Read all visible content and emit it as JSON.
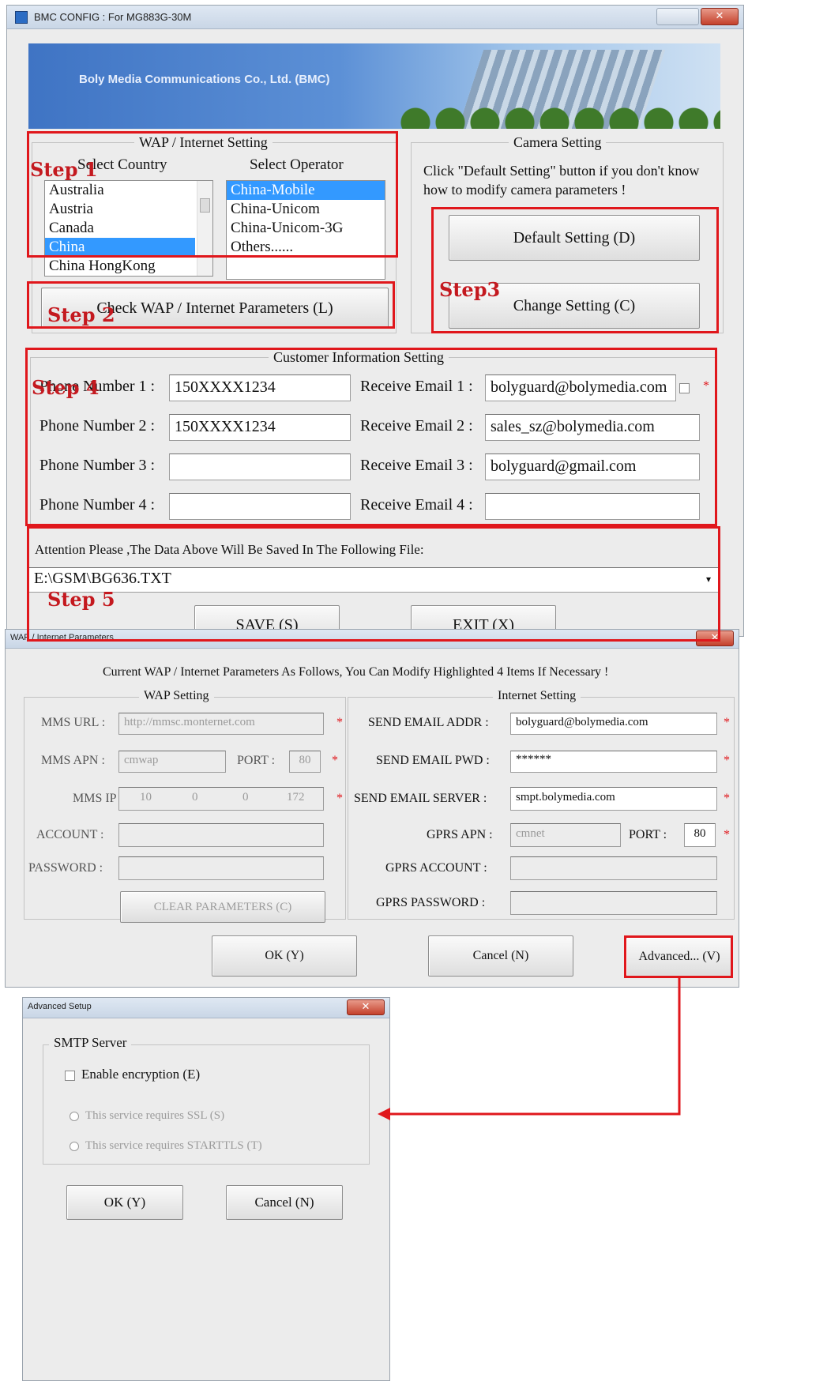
{
  "main_window": {
    "title": "BMC CONFIG : For MG883G-30M",
    "banner_text": "Boly Media Communications Co., Ltd. (BMC)",
    "wap_group": {
      "label": "WAP / Internet Setting",
      "country_label": "Select Country",
      "operator_label": "Select Operator",
      "countries": [
        "Australia",
        "Austria",
        "Canada",
        "China",
        "China HongKong"
      ],
      "selected_country": "China",
      "operators": [
        "China-Mobile",
        "China-Unicom",
        "China-Unicom-3G",
        "Others......"
      ],
      "selected_operator": "China-Mobile",
      "check_button": "Check WAP / Internet Parameters (L)"
    },
    "camera_group": {
      "label": "Camera Setting",
      "hint": "Click \"Default Setting\" button if you don't know how to modify camera parameters !",
      "default_button": "Default Setting (D)",
      "change_button": "Change Setting (C)"
    },
    "customer_group": {
      "label": "Customer Information Setting",
      "phone_labels": [
        "Phone Number 1 :",
        "Phone Number 2 :",
        "Phone Number 3 :",
        "Phone Number 4 :"
      ],
      "phone_values": [
        "150XXXX1234",
        "150XXXX1234",
        "",
        ""
      ],
      "email_labels": [
        "Receive Email 1 :",
        "Receive Email 2 :",
        "Receive Email 3 :",
        "Receive Email 4 :"
      ],
      "email_values": [
        "bolyguard@bolymedia.com",
        "sales_sz@bolymedia.com",
        "bolyguard@gmail.com",
        ""
      ]
    },
    "attention_text": "Attention Please ,The Data Above Will Be Saved In The Following  File:",
    "file_path": "E:\\GSM\\BG636.TXT",
    "save_button": "SAVE (S)",
    "exit_button": "EXIT (X)"
  },
  "steps": [
    "Step 1",
    "Step 2",
    "Step3",
    "Step 4",
    "Step 5"
  ],
  "wap_dialog": {
    "title": "WAP / Internet Parameters",
    "instruction": "Current WAP / Internet Parameters As Follows, You Can Modify Highlighted 4 Items If Necessary !",
    "wap_setting_label": "WAP Setting",
    "internet_setting_label": "Internet Setting",
    "mms_url_label": "MMS URL :",
    "mms_url_value": "http://mmsc.monternet.com",
    "mms_apn_label": "MMS APN :",
    "mms_apn_value": "cmwap",
    "port_label": "PORT :",
    "mms_port_value": "80",
    "mms_ip_label": "MMS IP :",
    "mms_ip_octets": [
      "10",
      "0",
      "0",
      "172"
    ],
    "account_label": "ACCOUNT :",
    "password_label": "PASSWORD :",
    "clear_button": "CLEAR PARAMETERS (C)",
    "send_email_addr_label": "SEND EMAIL ADDR :",
    "send_email_addr_value": "bolyguard@bolymedia.com",
    "send_email_pwd_label": "SEND EMAIL PWD :",
    "send_email_pwd_value": "******",
    "send_email_server_label": "SEND EMAIL SERVER :",
    "send_email_server_value": "smpt.bolymedia.com",
    "gprs_apn_label": "GPRS APN :",
    "gprs_apn_value": "cmnet",
    "gprs_port_value": "80",
    "gprs_account_label": "GPRS ACCOUNT :",
    "gprs_password_label": "GPRS PASSWORD :",
    "ok_button": "OK (Y)",
    "cancel_button": "Cancel (N)",
    "advanced_button": "Advanced... (V)",
    "required_mark": "*"
  },
  "advanced_dialog": {
    "title": "Advanced Setup",
    "group_label": "SMTP Server",
    "enable_encryption": "Enable encryption (E)",
    "ssl_option": "This service requires SSL (S)",
    "starttls_option": "This service requires  STARTTLS (T)",
    "ok_button": "OK (Y)",
    "cancel_button": "Cancel (N)"
  },
  "colors": {
    "annotation_red": "#e0171c",
    "step_text": "#c4191f",
    "selection_blue": "#3399ff"
  }
}
